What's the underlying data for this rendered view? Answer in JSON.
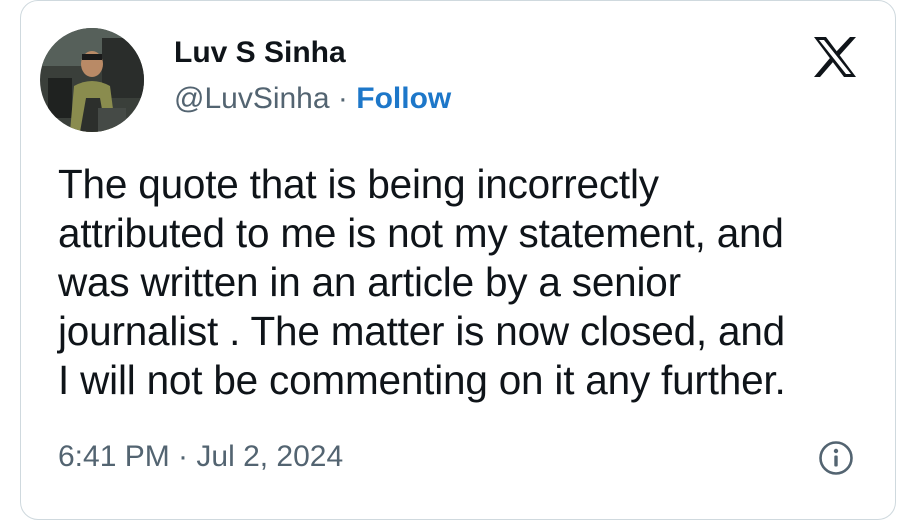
{
  "author": {
    "name": "Luv S Sinha",
    "handle": "@LuvSinha",
    "separator": "·",
    "follow_label": "Follow",
    "avatar_icon": "avatar-photo"
  },
  "platform_icon": "x-logo-icon",
  "tweet": {
    "lines": [
      "The quote that is being incorrectly",
      "attributed to me is not my statement, and",
      "was written in an article by a senior",
      "journalist . The matter is now closed, and",
      "I will not be commenting on it any further."
    ]
  },
  "footer": {
    "timestamp": "6:41 PM · Jul 2, 2024",
    "info_icon": "info-icon"
  },
  "colors": {
    "text": "#0f1419",
    "secondary": "#536471",
    "link": "#1d77c9",
    "border": "#cfd9de"
  }
}
